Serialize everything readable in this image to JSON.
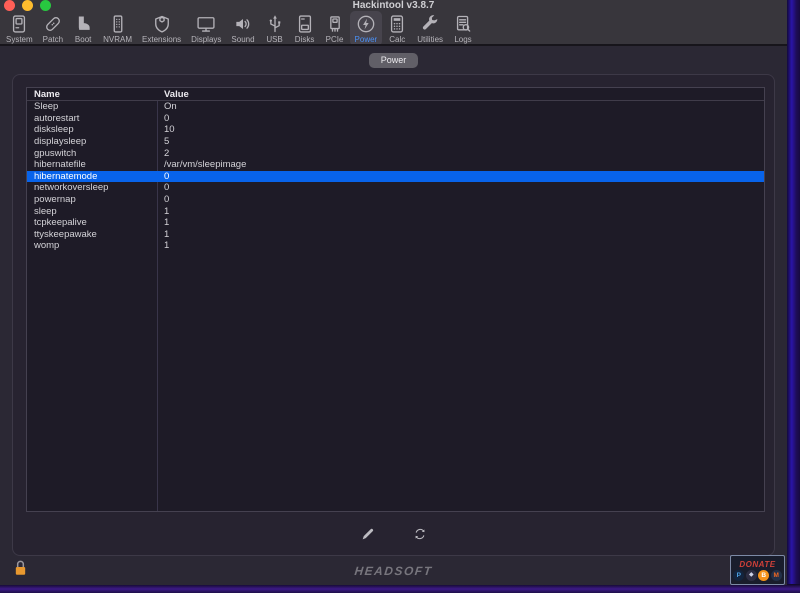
{
  "window": {
    "title": "Hackintool v3.8.7"
  },
  "toolbar": {
    "items": [
      {
        "label": "System"
      },
      {
        "label": "Patch"
      },
      {
        "label": "Boot"
      },
      {
        "label": "NVRAM"
      },
      {
        "label": "Extensions"
      },
      {
        "label": "Displays"
      },
      {
        "label": "Sound"
      },
      {
        "label": "USB"
      },
      {
        "label": "Disks"
      },
      {
        "label": "PCIe"
      },
      {
        "label": "Power",
        "selected": true
      },
      {
        "label": "Calc"
      },
      {
        "label": "Utilities"
      },
      {
        "label": "Logs"
      }
    ]
  },
  "tabbar": {
    "selected_tab": "Power"
  },
  "power_table": {
    "columns": {
      "name": "Name",
      "value": "Value"
    },
    "rows": [
      {
        "name": "Sleep",
        "value": "On"
      },
      {
        "name": "autorestart",
        "value": "0"
      },
      {
        "name": "disksleep",
        "value": "10"
      },
      {
        "name": "displaysleep",
        "value": "5"
      },
      {
        "name": "gpuswitch",
        "value": "2"
      },
      {
        "name": "hibernatefile",
        "value": "/var/vm/sleepimage"
      },
      {
        "name": "hibernatemode",
        "value": "0",
        "selected": true
      },
      {
        "name": "networkoversleep",
        "value": "0"
      },
      {
        "name": "powernap",
        "value": "0"
      },
      {
        "name": "sleep",
        "value": "1"
      },
      {
        "name": "tcpkeepalive",
        "value": "1"
      },
      {
        "name": "ttyskeepawake",
        "value": "1"
      },
      {
        "name": "womp",
        "value": "1"
      }
    ]
  },
  "footer": {
    "brand": "HEADSOFT",
    "donate": {
      "label": "DONATE",
      "icons": [
        {
          "name": "paypal",
          "glyph": "P"
        },
        {
          "name": "ethereum",
          "glyph": "◆"
        },
        {
          "name": "bitcoin",
          "glyph": "B"
        },
        {
          "name": "monero",
          "glyph": "M"
        }
      ]
    }
  },
  "colors": {
    "selection_blue": "#0863ea",
    "toolbar_selected_label": "#4a90f5",
    "lock_orange": "#e8982f",
    "donate_red": "#d04038",
    "desktop_purple": "#2a14a8"
  }
}
